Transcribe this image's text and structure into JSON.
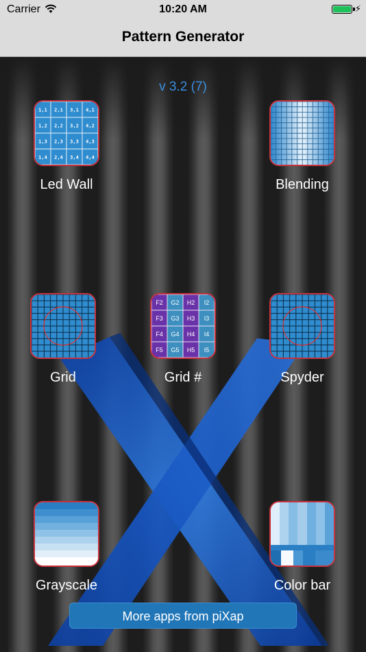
{
  "status": {
    "carrier": "Carrier",
    "time": "10:20 AM"
  },
  "nav": {
    "title": "Pattern Generator"
  },
  "version": "v 3.2 (7)",
  "apps": [
    {
      "label": "Led Wall",
      "icon": "led-wall-icon"
    },
    {
      "label": "Blending",
      "icon": "blending-icon"
    },
    {
      "label": "Grid",
      "icon": "grid-icon"
    },
    {
      "label": "Grid #",
      "icon": "grid-number-icon"
    },
    {
      "label": "Spyder",
      "icon": "spyder-icon"
    },
    {
      "label": "Grayscale",
      "icon": "grayscale-icon"
    },
    {
      "label": "Color bar",
      "icon": "color-bar-icon"
    }
  ],
  "led_wall_cells": [
    "1,1",
    "2,1",
    "3,1",
    "4,1",
    "1,2",
    "2,2",
    "3,2",
    "4,2",
    "1,3",
    "2,3",
    "3,3",
    "4,3",
    "1,4",
    "2,4",
    "3,4",
    "4,4"
  ],
  "grid_number_cells": [
    "F2",
    "G2",
    "H2",
    "I2",
    "F3",
    "G3",
    "H3",
    "I3",
    "F4",
    "G4",
    "H4",
    "I4",
    "F5",
    "G5",
    "H5",
    "I5"
  ],
  "more_button": "More apps from piXap",
  "colors": {
    "accent": "#3b8ee0",
    "button": "#2176b8",
    "icon_border": "#c8323c"
  }
}
